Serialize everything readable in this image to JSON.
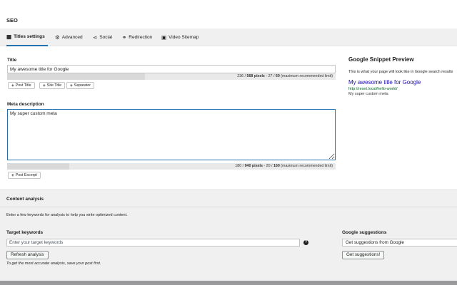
{
  "panel": {
    "title": "SEO"
  },
  "tabs": [
    {
      "label": "Titles settings",
      "icon": "table-icon",
      "active": true
    },
    {
      "label": "Advanced",
      "icon": "gear-icon"
    },
    {
      "label": "Social",
      "icon": "share-icon"
    },
    {
      "label": "Redirection",
      "icon": "link-icon"
    },
    {
      "label": "Video Sitemap",
      "icon": "video-icon"
    }
  ],
  "title_field": {
    "label": "Title",
    "value": "My awesome title for Google",
    "counter": {
      "pixels": "236",
      "pixels_limit": "568 pixels",
      "chars": "27",
      "chars_limit": "60",
      "suffix": "(maximum recommended limit)",
      "fill": 0.42
    }
  },
  "title_variables": [
    "Post Title",
    "Site Title",
    "Separator"
  ],
  "meta_field": {
    "label": "Meta description",
    "value": "My super custom meta ",
    "counter": {
      "pixels": "180",
      "pixels_limit": "940 pixels",
      "chars": "20",
      "chars_limit": "160",
      "suffix": "(maximum recommended limit)",
      "fill": 0.19
    }
  },
  "meta_variables": [
    "Post Excerpt"
  ],
  "snippet": {
    "title": "Google Snippet Preview",
    "description": "This is what your page will look like in Google search results",
    "link_title": "My awesome title for Google",
    "url": "http://reset.local/hello-world/",
    "meta": "My super custom meta"
  },
  "content_analysis": {
    "title": "Content analysis",
    "intro": "Enter a few keywords for analysis to help you write optimized content.",
    "keywords_label": "Target keywords",
    "keywords_placeholder": "Enter your target keywords",
    "refresh_label": "Refresh analysis",
    "note": "To get the most accurate analysis, save your post first.",
    "suggestions_label": "Google suggestions",
    "suggestions_value": "Get suggestions from Google",
    "suggestions_button": "Get suggestions!"
  },
  "colors": {
    "accent": "#2271b1",
    "snippet_link": "#1a0dab",
    "snippet_url": "#006621"
  }
}
